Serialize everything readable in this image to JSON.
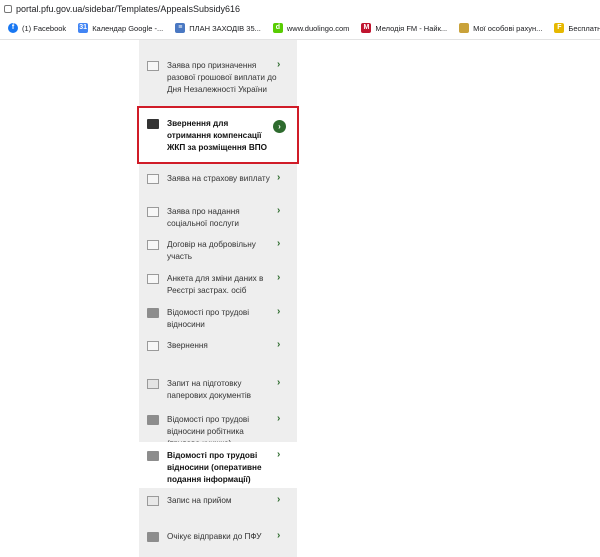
{
  "browser": {
    "url": "portal.pfu.gov.ua/sidebar/Templates/AppealsSubsidy616",
    "bookmarks": [
      {
        "label": "(1) Facebook",
        "icon": "facebook-icon",
        "color": "#1877f2"
      },
      {
        "label": "Календар Google -...",
        "icon": "google-calendar-icon",
        "color": "#4285f4"
      },
      {
        "label": "ПЛАН ЗАХОДІВ 35...",
        "icon": "doc-icon",
        "color": "#4a78c2"
      },
      {
        "label": "www.duolingo.com",
        "icon": "duolingo-icon",
        "color": "#58cc02"
      },
      {
        "label": "Мелодія FM - Найк...",
        "icon": "melodia-icon",
        "color": "#c0142f"
      },
      {
        "label": "Мої особові рахун...",
        "icon": "folder-icon",
        "color": "#c9a23a"
      },
      {
        "label": "Бесплатный Фотош...",
        "icon": "photoshop-icon",
        "color": "#e6b800"
      }
    ]
  },
  "sidebar": {
    "items": [
      {
        "label": "Заява про призначення разової грошової виплати до Дня Незалежності України",
        "icon": "envelope-icon"
      },
      {
        "label": "Звернення для отримання компенсації ЖКП за розміщення ВПО",
        "icon": "folder-icon"
      },
      {
        "label": "Заява на страхову виплату",
        "icon": "envelope-icon"
      },
      {
        "label": "Заява про надання соціальної послуги",
        "icon": "envelope-icon"
      },
      {
        "label": "Договір на добровільну участь",
        "icon": "envelope-icon"
      },
      {
        "label": "Анкета для зміни даних в Реєстрі застрах. осіб",
        "icon": "checklist-icon"
      },
      {
        "label": "Відомості про трудові відносини",
        "icon": "folder-icon"
      },
      {
        "label": "Звернення",
        "icon": "envelope-icon"
      },
      {
        "label": "Запит на підготовку паперових документів",
        "icon": "printer-icon"
      },
      {
        "label": "Відомості про трудові відносини робітника (трудова книжка)",
        "icon": "folder-icon"
      },
      {
        "label": "Відомості про трудові відносини (оперативне подання інформації)",
        "icon": "folder-icon"
      },
      {
        "label": "Запис на прийом",
        "icon": "calendar-icon"
      },
      {
        "label": "Очікує відправки до ПФУ",
        "icon": "folder-icon"
      }
    ]
  }
}
